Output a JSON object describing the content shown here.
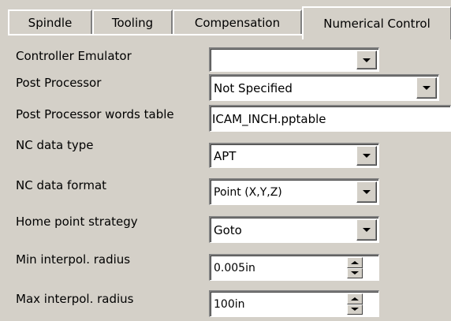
{
  "tabs": [
    {
      "label": "Spindle"
    },
    {
      "label": "Tooling"
    },
    {
      "label": "Compensation"
    },
    {
      "label": "Numerical Control"
    }
  ],
  "form": {
    "controller_emulator": {
      "label": "Controller Emulator",
      "value": ""
    },
    "post_processor": {
      "label": "Post Processor",
      "value": "Not Specified"
    },
    "post_processor_words_table": {
      "label": "Post Processor words table",
      "value": "ICAM_INCH.pptable"
    },
    "nc_data_type": {
      "label": "NC data type",
      "value": "APT"
    },
    "nc_data_format": {
      "label": "NC data format",
      "value": "Point (X,Y,Z)"
    },
    "home_point_strategy": {
      "label": "Home point strategy",
      "value": "Goto"
    },
    "min_interpol_radius": {
      "label": "Min interpol. radius",
      "value": "0.005in"
    },
    "max_interpol_radius": {
      "label": "Max interpol. radius",
      "value": "100in"
    }
  }
}
